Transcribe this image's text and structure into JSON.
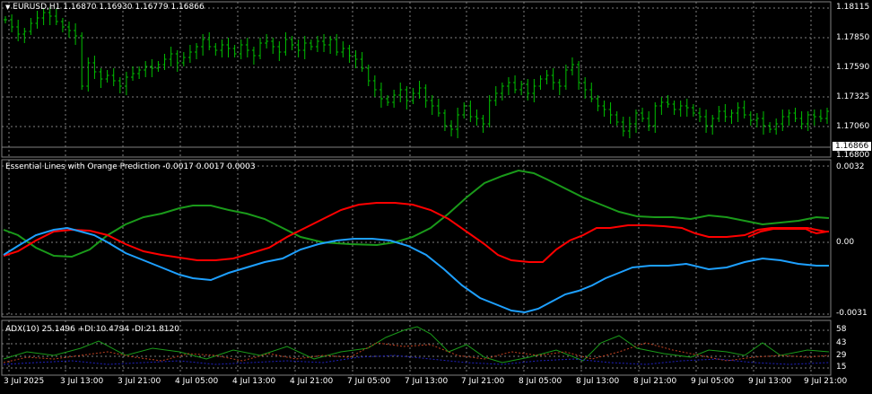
{
  "colors": {
    "background": "#000000",
    "grid": "#808080",
    "bars": "#00c000",
    "orange_line": "#ff0000",
    "green_line": "#1a9a1a",
    "blue_line": "#1ea0ff",
    "current_price_line": "#808080"
  },
  "price_pane": {
    "header": "EURUSD,H1  1.16870 1.16930 1.16779 1.16866",
    "symbol_menu_icon": "triangle-down-icon",
    "ticks": [
      "1.18115",
      "1.17850",
      "1.17590",
      "1.17325",
      "1.17060",
      "1.16800"
    ],
    "current_price": "1.16866"
  },
  "indicator_pane": {
    "header": "Essential Lines with Orange Prediction -0.0017 0.0017 0.0003",
    "ticks": [
      "0.0032",
      "0.00",
      "-0.0031"
    ]
  },
  "adx_pane": {
    "header": "ADX(10) 25.1496 +DI:10.4794 -DI:21.8120",
    "ticks": [
      "58",
      "43",
      "29",
      "15"
    ]
  },
  "time_axis": {
    "labels": [
      "3 Jul 2025",
      "3 Jul 13:00",
      "3 Jul 21:00",
      "4 Jul 05:00",
      "4 Jul 13:00",
      "4 Jul 21:00",
      "7 Jul 05:00",
      "7 Jul 13:00",
      "7 Jul 21:00",
      "8 Jul 05:00",
      "8 Jul 13:00",
      "8 Jul 21:00",
      "9 Jul 05:00",
      "9 Jul 13:00",
      "9 Jul 21:00"
    ]
  }
}
